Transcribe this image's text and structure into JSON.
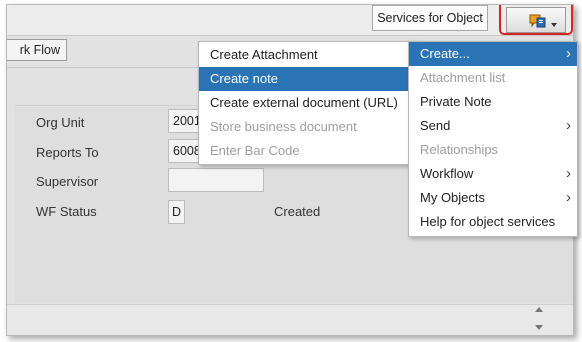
{
  "toolbar": {
    "services_label": "Services for Object",
    "services_icon": "object-services-icon"
  },
  "workflow_button": {
    "label": "rk Flow"
  },
  "form": {
    "org_unit": {
      "label": "Org Unit",
      "value": "2001"
    },
    "reports_to": {
      "label": "Reports To",
      "value": "6008"
    },
    "supervisor": {
      "label": "Supervisor",
      "value": ""
    },
    "wf_status": {
      "label": "WF Status",
      "value": "D",
      "status_text": "Created"
    }
  },
  "services_menu": {
    "items": [
      {
        "label": "Create...",
        "enabled": true,
        "selected": true,
        "has_submenu": true
      },
      {
        "label": "Attachment list",
        "enabled": false,
        "selected": false,
        "has_submenu": false
      },
      {
        "label": "Private Note",
        "enabled": true,
        "selected": false,
        "has_submenu": false
      },
      {
        "label": "Send",
        "enabled": true,
        "selected": false,
        "has_submenu": true
      },
      {
        "label": "Relationships",
        "enabled": false,
        "selected": false,
        "has_submenu": false
      },
      {
        "label": "Workflow",
        "enabled": true,
        "selected": false,
        "has_submenu": true
      },
      {
        "label": "My Objects",
        "enabled": true,
        "selected": false,
        "has_submenu": true
      },
      {
        "label": "Help for object services",
        "enabled": true,
        "selected": false,
        "has_submenu": false
      }
    ]
  },
  "create_submenu": {
    "items": [
      {
        "label": "Create Attachment",
        "enabled": true,
        "selected": false
      },
      {
        "label": "Create note",
        "enabled": true,
        "selected": true
      },
      {
        "label": "Create external document (URL)",
        "enabled": true,
        "selected": false
      },
      {
        "label": "Store business document",
        "enabled": false,
        "selected": false
      },
      {
        "label": "Enter Bar Code",
        "enabled": false,
        "selected": false
      }
    ]
  },
  "colors": {
    "highlight": "#2a73b5",
    "callout_border": "#d52424",
    "disabled_text": "#9e9e9e"
  }
}
